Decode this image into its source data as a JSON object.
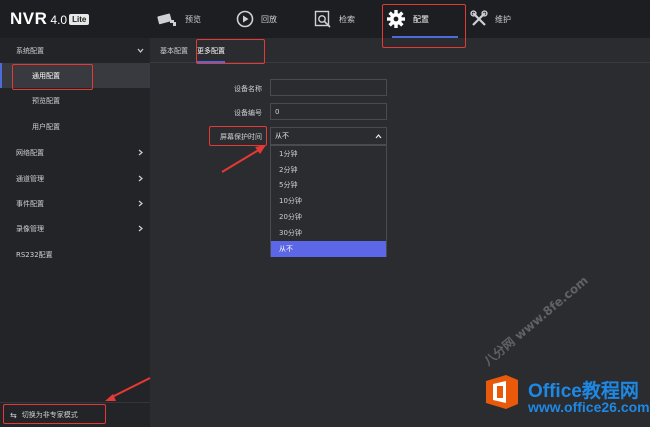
{
  "app": {
    "brand": "NVR",
    "version": "4.0",
    "edition": "Lite"
  },
  "nav": [
    {
      "label": "预览",
      "icon": "camera-icon"
    },
    {
      "label": "回放",
      "icon": "playback-icon"
    },
    {
      "label": "检索",
      "icon": "search-icon"
    },
    {
      "label": "配置",
      "icon": "gear-icon",
      "active": true
    },
    {
      "label": "维护",
      "icon": "tools-icon"
    }
  ],
  "sidebar": {
    "items": [
      {
        "label": "系统配置",
        "expanded": true
      },
      {
        "label": "通用配置",
        "active": true
      },
      {
        "label": "预览配置"
      },
      {
        "label": "用户配置"
      },
      {
        "label": "网络配置"
      },
      {
        "label": "通道管理"
      },
      {
        "label": "事件配置"
      },
      {
        "label": "录像管理"
      },
      {
        "label": "RS232配置"
      }
    ],
    "bottom_label": "切换为非专家模式",
    "bottom_icon": "swap-icon"
  },
  "tabs": [
    {
      "label": "基本配置"
    },
    {
      "label": "更多配置",
      "active": true
    }
  ],
  "form": {
    "device_name": {
      "label": "设备名称",
      "value": ""
    },
    "device_number": {
      "label": "设备编号",
      "value": "0"
    },
    "screensaver": {
      "label": "屏幕保护时间",
      "value": "从不",
      "options": [
        "1分钟",
        "2分钟",
        "5分钟",
        "10分钟",
        "20分钟",
        "30分钟",
        "从不"
      ],
      "selected_index": 6
    }
  },
  "watermark": {
    "diagonal_text": "八分网 www.8fe.com",
    "office_text": "Office教程网",
    "office_url": "www.office26.com"
  },
  "colors": {
    "accent": "#4e6bdb",
    "selected_option": "#5b67e6",
    "annotation": "#e53935",
    "office_blue": "#1e88e5"
  }
}
